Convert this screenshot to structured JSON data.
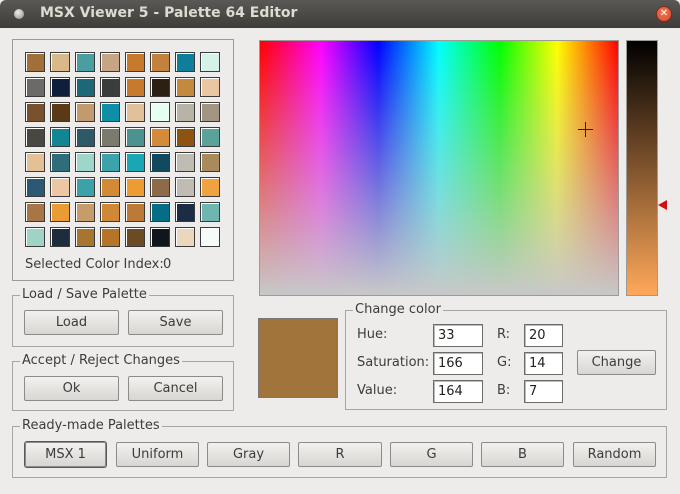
{
  "window": {
    "title": "MSX Viewer 5 - Palette 64 Editor",
    "close_glyph": "✕"
  },
  "palette": {
    "colors": [
      "#a16f3a",
      "#d8b98a",
      "#4b9ea0",
      "#c6a585",
      "#c7792e",
      "#c2823e",
      "#0f7e9a",
      "#d6f2e8",
      "#6c6a66",
      "#0f1e3a",
      "#1d6779",
      "#3b3c3c",
      "#c77a2d",
      "#2c1f13",
      "#c3893f",
      "#e8c7a2",
      "#7a512d",
      "#593a15",
      "#c39a6d",
      "#0f8ea8",
      "#e1c19a",
      "#e6fff0",
      "#b8b3a7",
      "#a29682",
      "#4a4743",
      "#138593",
      "#2c5a69",
      "#7b7a6d",
      "#4c9390",
      "#d38a3a",
      "#8c5313",
      "#5aa39b",
      "#e4c096",
      "#2f6d7a",
      "#9cd7c9",
      "#3da3aa",
      "#1aa6b2",
      "#114a5e",
      "#c1bcb3",
      "#a98a5d",
      "#2b5973",
      "#edc7a3",
      "#3ba2a8",
      "#d38a35",
      "#ed9c33",
      "#8d6b48",
      "#c0bcb3",
      "#f0a140",
      "#a77546",
      "#e99b34",
      "#c59c6a",
      "#cf8738",
      "#bb7a37",
      "#066d87",
      "#1a2d44",
      "#6fb6b0",
      "#9ed3c6",
      "#1f2c3b",
      "#a87530",
      "#b57426",
      "#6c4a26",
      "#11151e",
      "#ead7bc",
      "#f5fbf8"
    ],
    "selected_label": "Selected Color Index:",
    "selected_index": "0"
  },
  "load_save": {
    "title": "Load / Save Palette",
    "load_label": "Load",
    "save_label": "Save"
  },
  "accept_reject": {
    "title": "Accept / Reject Changes",
    "ok_label": "Ok",
    "cancel_label": "Cancel"
  },
  "change_color": {
    "title": "Change color",
    "preview_color": "#a1743b",
    "hue_label": "Hue:",
    "hue_value": "33",
    "saturation_label": "Saturation:",
    "saturation_value": "166",
    "value_label": "Value:",
    "value_value": "164",
    "r_label": "R:",
    "r_value": "20",
    "g_label": "G:",
    "g_value": "14",
    "b_label": "B:",
    "b_value": "7",
    "change_label": "Change"
  },
  "ready_made": {
    "title": "Ready-made Palettes",
    "buttons": [
      "MSX 1",
      "Uniform",
      "Gray",
      "R",
      "G",
      "B",
      "Random"
    ]
  }
}
